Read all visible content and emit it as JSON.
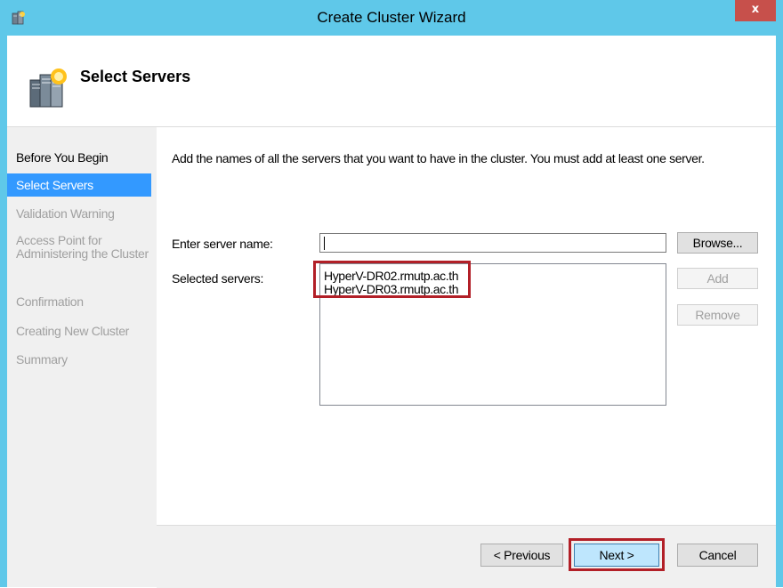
{
  "window": {
    "title": "Create Cluster Wizard",
    "close_label": "x"
  },
  "header": {
    "title": "Select Servers"
  },
  "nav": {
    "items": [
      {
        "label": "Before You Begin",
        "state": "done"
      },
      {
        "label": "Select Servers",
        "state": "active"
      },
      {
        "label": "Validation Warning",
        "state": "pending"
      },
      {
        "label": "Access Point for Administering the Cluster",
        "state": "pending"
      },
      {
        "label": "Confirmation",
        "state": "pending"
      },
      {
        "label": "Creating New Cluster",
        "state": "pending"
      },
      {
        "label": "Summary",
        "state": "pending"
      }
    ]
  },
  "content": {
    "instructions": "Add the names of all the servers that you want to have in the cluster. You must add at least one server.",
    "server_name_label": "Enter server name:",
    "server_name_value": "",
    "selected_label": "Selected servers:",
    "selected_servers": [
      "HyperV-DR02.rmutp.ac.th",
      "HyperV-DR03.rmutp.ac.th"
    ],
    "browse_label": "Browse...",
    "add_label": "Add",
    "remove_label": "Remove"
  },
  "footer": {
    "previous_label": "< Previous",
    "next_label": "Next >",
    "cancel_label": "Cancel"
  },
  "colors": {
    "title_bar": "#5fc8e9",
    "selection": "#3399ff",
    "highlight_box": "#b21f27",
    "close_button": "#c7504b"
  }
}
